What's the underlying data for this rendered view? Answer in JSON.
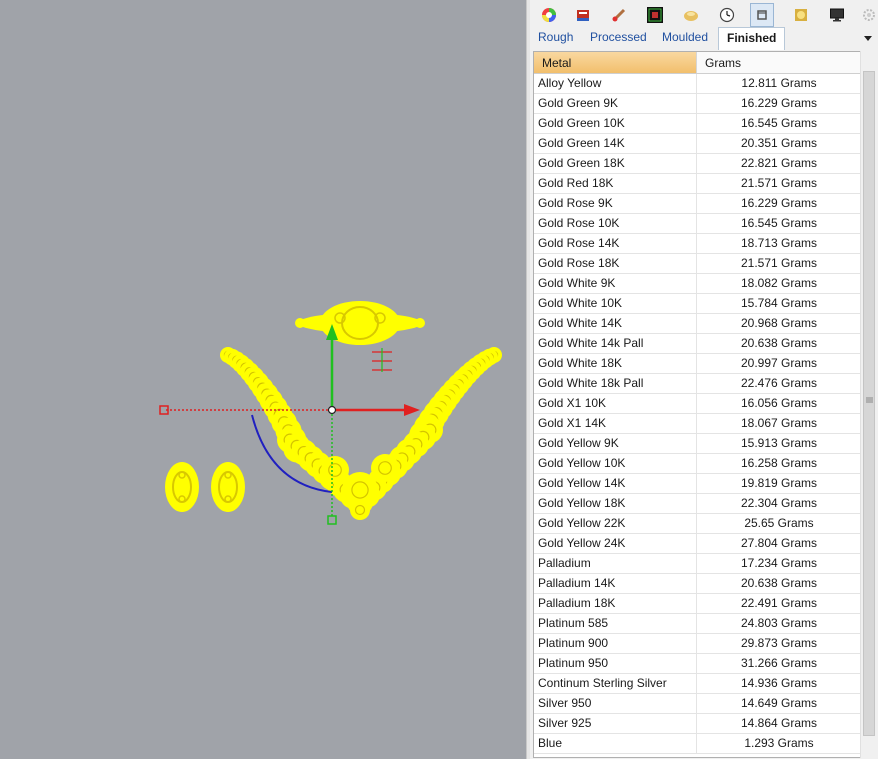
{
  "toolbar": {
    "icons": [
      "color-wheel-icon",
      "book-icon",
      "brush-icon",
      "rg-logo-icon",
      "stone-icon",
      "clock-icon",
      "ring-icon",
      "material-icon",
      "monitor-icon",
      "gear-icon"
    ],
    "active_index": 6
  },
  "tabs": [
    {
      "label": "Rough",
      "active": false
    },
    {
      "label": "Processed",
      "active": false
    },
    {
      "label": "Moulded",
      "active": false
    },
    {
      "label": "Finished",
      "active": true
    }
  ],
  "table": {
    "columns": [
      "Metal",
      "Grams"
    ],
    "rows": [
      {
        "metal": "Alloy Yellow",
        "grams": "12.811 Grams"
      },
      {
        "metal": "Gold Green 9K",
        "grams": "16.229 Grams"
      },
      {
        "metal": "Gold Green 10K",
        "grams": "16.545 Grams"
      },
      {
        "metal": "Gold Green 14K",
        "grams": "20.351 Grams"
      },
      {
        "metal": "Gold Green 18K",
        "grams": "22.821 Grams"
      },
      {
        "metal": "Gold Red 18K",
        "grams": "21.571 Grams"
      },
      {
        "metal": "Gold Rose 9K",
        "grams": "16.229 Grams"
      },
      {
        "metal": "Gold Rose 10K",
        "grams": "16.545 Grams"
      },
      {
        "metal": "Gold Rose 14K",
        "grams": "18.713 Grams"
      },
      {
        "metal": "Gold Rose 18K",
        "grams": "21.571 Grams"
      },
      {
        "metal": "Gold White 9K",
        "grams": "18.082 Grams"
      },
      {
        "metal": "Gold White 10K",
        "grams": "15.784 Grams"
      },
      {
        "metal": "Gold White 14K",
        "grams": "20.968 Grams"
      },
      {
        "metal": "Gold White 14k Pall",
        "grams": "20.638 Grams"
      },
      {
        "metal": "Gold White 18K",
        "grams": "20.997 Grams"
      },
      {
        "metal": "Gold White 18k Pall",
        "grams": "22.476 Grams"
      },
      {
        "metal": "Gold X1 10K",
        "grams": "16.056 Grams"
      },
      {
        "metal": "Gold X1 14K",
        "grams": "18.067 Grams"
      },
      {
        "metal": "Gold Yellow 9K",
        "grams": "15.913 Grams"
      },
      {
        "metal": "Gold Yellow 10K",
        "grams": "16.258 Grams"
      },
      {
        "metal": "Gold Yellow 14K",
        "grams": "19.819 Grams"
      },
      {
        "metal": "Gold Yellow 18K",
        "grams": "22.304 Grams"
      },
      {
        "metal": "Gold Yellow 22K",
        "grams": "25.65 Grams"
      },
      {
        "metal": "Gold Yellow 24K",
        "grams": "27.804 Grams"
      },
      {
        "metal": "Palladium",
        "grams": "17.234 Grams"
      },
      {
        "metal": "Palladium 14K",
        "grams": "20.638 Grams"
      },
      {
        "metal": "Palladium 18K",
        "grams": "22.491 Grams"
      },
      {
        "metal": "Platinum 585",
        "grams": "24.803 Grams"
      },
      {
        "metal": "Platinum 900",
        "grams": "29.873 Grams"
      },
      {
        "metal": "Platinum 950",
        "grams": "31.266 Grams"
      },
      {
        "metal": "Continum Sterling Silver",
        "grams": "14.936 Grams"
      },
      {
        "metal": "Silver 950",
        "grams": "14.649 Grams"
      },
      {
        "metal": "Silver 925",
        "grams": "14.864 Grams"
      },
      {
        "metal": "Blue",
        "grams": "1.293 Grams"
      }
    ]
  },
  "viewport": {
    "background": "#a0a3a9",
    "selection_color": "#ffff00",
    "gumball_x_color": "#e02020",
    "gumball_y_color": "#20c020",
    "rotate_arc_color": "#2020c0"
  }
}
